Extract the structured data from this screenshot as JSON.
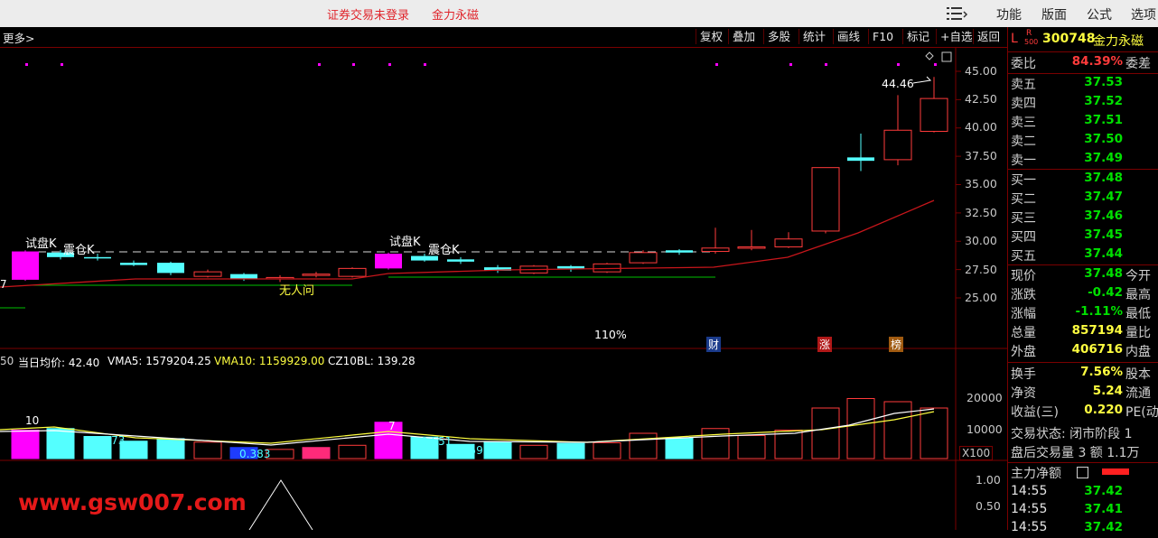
{
  "window": {
    "title_status": "证券交易未登录",
    "title_stock": "金力永磁",
    "menu_icon": "list-icon",
    "menu": [
      "功能",
      "版面",
      "公式",
      "选项"
    ]
  },
  "toolbar": {
    "more": "更多>",
    "buttons": [
      "复权",
      "叠加",
      "多股",
      "统计",
      "画线",
      "F10",
      "标记",
      "+自选",
      "返回"
    ]
  },
  "chart_labels": {
    "trial_k_1": "试盘K",
    "shake_k_1": "震仓K",
    "trial_k_2": "试盘K",
    "shake_k_2": "震仓K",
    "no_one": "无人问",
    "pct": "110%",
    "last_label": "44.46",
    "edge_seven": "7",
    "tag_cai": "财",
    "tag_zhang": "涨",
    "tag_bang": "榜",
    "ind_prefix": "50",
    "ind_avg": "当日均价: 42.40",
    "ind_vma5": "VMA5: 1579204.25",
    "ind_vma10": "VMA10: 1159929.00",
    "ind_cz": "CZ10BL: 139.28",
    "vol_small_1": "0.873",
    "vol_small_2": "0.383",
    "vol_small_3": "0.551",
    "vol_small_4": "0.597",
    "vol_big_1": "10",
    "vol_big_2": "7",
    "unit": "X100",
    "watermark": "www.gsw007.com"
  },
  "price_axis": [
    "45.00",
    "42.50",
    "40.00",
    "37.50",
    "35.00",
    "32.50",
    "30.00",
    "27.50",
    "25.00"
  ],
  "vol_axis": [
    "20000",
    "10000"
  ],
  "lower_axis": [
    "1.00",
    "0.50"
  ],
  "quote": {
    "market_tag": "L",
    "market_tag2": "R",
    "market_tag3": "500",
    "code": "300748",
    "name": "金力永磁",
    "wei_bi_label": "委比",
    "wei_bi": "84.39%",
    "wei_cha": "委差",
    "sells": [
      {
        "label": "卖五",
        "price": "37.53"
      },
      {
        "label": "卖四",
        "price": "37.52"
      },
      {
        "label": "卖三",
        "price": "37.51"
      },
      {
        "label": "卖二",
        "price": "37.50"
      },
      {
        "label": "卖一",
        "price": "37.49"
      }
    ],
    "buys": [
      {
        "label": "买一",
        "price": "37.48"
      },
      {
        "label": "买二",
        "price": "37.47"
      },
      {
        "label": "买三",
        "price": "37.46"
      },
      {
        "label": "买四",
        "price": "37.45"
      },
      {
        "label": "买五",
        "price": "37.44"
      }
    ],
    "stats": [
      {
        "label": "现价",
        "value": "37.48",
        "extra": "今开"
      },
      {
        "label": "涨跌",
        "value": "-0.42",
        "extra": "最高"
      },
      {
        "label": "涨幅",
        "value": "-1.11%",
        "extra": "最低"
      },
      {
        "label": "总量",
        "value": "857194",
        "extra": "量比"
      },
      {
        "label": "外盘",
        "value": "406716",
        "extra": "内盘"
      }
    ],
    "stats2": [
      {
        "label": "换手",
        "value": "7.56%",
        "extra": "股本"
      },
      {
        "label": "净资",
        "value": "5.24",
        "extra": "流通"
      },
      {
        "label": "收益(三)",
        "value": "0.220",
        "extra": "PE(动"
      }
    ],
    "trade_state": "交易状态: 闭市阶段 1",
    "after_hours": "盘后交易量 3 额 1.1万",
    "main_net": "主力净额",
    "ticks": [
      {
        "time": "14:55",
        "price": "37.42"
      },
      {
        "time": "14:55",
        "price": "37.41"
      },
      {
        "time": "14:55",
        "price": "37.42"
      }
    ]
  },
  "colors": {
    "up": "#ff3b3b",
    "down": "#54ffff",
    "magenta": "#ff00ff",
    "ma_line": "#c8161b",
    "green_line": "#00c000"
  },
  "candles": [
    {
      "o": 26.6,
      "c": 29.1,
      "h": 29.2,
      "l": 26.5,
      "t": "hot"
    },
    {
      "o": 29.0,
      "c": 28.6,
      "h": 29.2,
      "l": 28.4,
      "t": "down"
    },
    {
      "o": 28.6,
      "c": 28.6,
      "h": 28.9,
      "l": 28.3,
      "t": "down"
    },
    {
      "o": 28.1,
      "c": 27.9,
      "h": 28.3,
      "l": 27.8,
      "t": "down"
    },
    {
      "o": 28.1,
      "c": 27.2,
      "h": 28.2,
      "l": 27.0,
      "t": "down"
    },
    {
      "o": 26.9,
      "c": 27.3,
      "h": 27.5,
      "l": 26.8,
      "t": "up"
    },
    {
      "o": 27.1,
      "c": 26.7,
      "h": 27.2,
      "l": 26.5,
      "t": "down"
    },
    {
      "o": 26.8,
      "c": 26.7,
      "h": 27.0,
      "l": 26.4,
      "t": "up"
    },
    {
      "o": 27.0,
      "c": 27.1,
      "h": 27.3,
      "l": 26.8,
      "t": "up"
    },
    {
      "o": 26.9,
      "c": 27.6,
      "h": 27.7,
      "l": 26.8,
      "t": "up"
    },
    {
      "o": 27.6,
      "c": 28.9,
      "h": 29.0,
      "l": 27.5,
      "t": "hot"
    },
    {
      "o": 28.7,
      "c": 28.3,
      "h": 28.9,
      "l": 28.2,
      "t": "down"
    },
    {
      "o": 28.4,
      "c": 28.2,
      "h": 28.6,
      "l": 28.0,
      "t": "down"
    },
    {
      "o": 27.7,
      "c": 27.4,
      "h": 27.9,
      "l": 27.2,
      "t": "down"
    },
    {
      "o": 27.2,
      "c": 27.8,
      "h": 27.9,
      "l": 27.1,
      "t": "up"
    },
    {
      "o": 27.8,
      "c": 27.6,
      "h": 27.9,
      "l": 27.3,
      "t": "down"
    },
    {
      "o": 27.3,
      "c": 28.0,
      "h": 28.1,
      "l": 27.2,
      "t": "up"
    },
    {
      "o": 28.1,
      "c": 29.0,
      "h": 29.2,
      "l": 28.0,
      "t": "up"
    },
    {
      "o": 29.2,
      "c": 29.0,
      "h": 29.3,
      "l": 28.8,
      "t": "down"
    },
    {
      "o": 29.1,
      "c": 29.4,
      "h": 31.2,
      "l": 28.9,
      "t": "up"
    },
    {
      "o": 29.4,
      "c": 29.5,
      "h": 31.0,
      "l": 29.2,
      "t": "up"
    },
    {
      "o": 29.5,
      "c": 30.2,
      "h": 30.8,
      "l": 29.4,
      "t": "up"
    },
    {
      "o": 30.9,
      "c": 36.5,
      "h": 36.5,
      "l": 30.7,
      "t": "up"
    },
    {
      "o": 37.4,
      "c": 37.1,
      "h": 39.5,
      "l": 36.2,
      "t": "down"
    },
    {
      "o": 37.2,
      "c": 39.8,
      "h": 42.9,
      "l": 36.7,
      "t": "up"
    },
    {
      "o": 39.7,
      "c": 42.6,
      "h": 44.5,
      "l": 39.6,
      "t": "up"
    }
  ],
  "volumes": [
    {
      "v": 9000,
      "t": "hot"
    },
    {
      "v": 9500,
      "t": "down"
    },
    {
      "v": 7000,
      "t": "down"
    },
    {
      "v": 5500,
      "t": "down"
    },
    {
      "v": 6300,
      "t": "down"
    },
    {
      "v": 5200,
      "t": "up"
    },
    {
      "v": 3500,
      "t": "blue"
    },
    {
      "v": 2900,
      "t": "up"
    },
    {
      "v": 3500,
      "t": "magfill"
    },
    {
      "v": 4200,
      "t": "up"
    },
    {
      "v": 11500,
      "t": "hot"
    },
    {
      "v": 6800,
      "t": "down"
    },
    {
      "v": 4500,
      "t": "down"
    },
    {
      "v": 5200,
      "t": "down"
    },
    {
      "v": 4200,
      "t": "up"
    },
    {
      "v": 4800,
      "t": "down"
    },
    {
      "v": 5000,
      "t": "up"
    },
    {
      "v": 8000,
      "t": "up"
    },
    {
      "v": 6600,
      "t": "down"
    },
    {
      "v": 9500,
      "t": "up"
    },
    {
      "v": 7300,
      "t": "up"
    },
    {
      "v": 9000,
      "t": "up"
    },
    {
      "v": 16000,
      "t": "up"
    },
    {
      "v": 19000,
      "t": "up"
    },
    {
      "v": 18000,
      "t": "up"
    },
    {
      "v": 16000,
      "t": "up"
    }
  ]
}
